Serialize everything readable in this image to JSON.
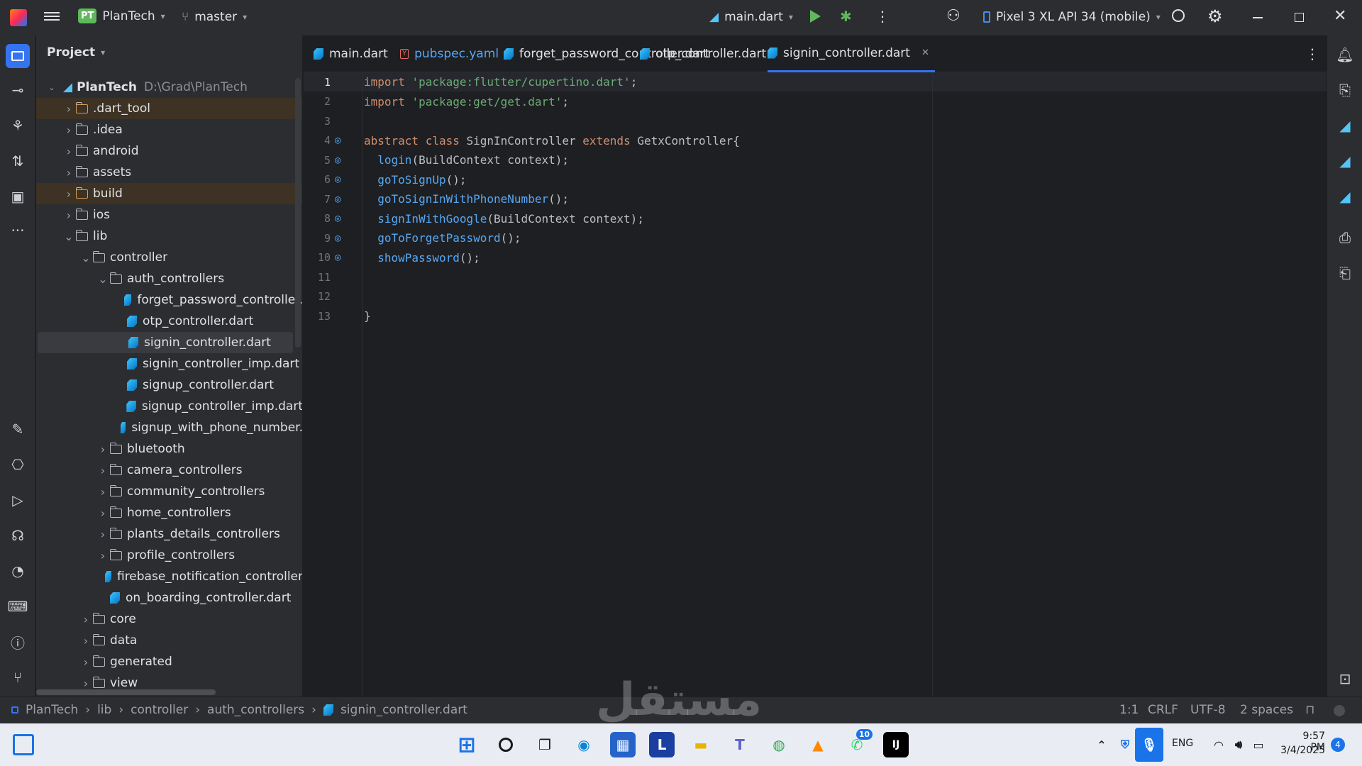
{
  "titlebar": {
    "project_initials": "PT",
    "project_name": "PlanTech",
    "branch": "master",
    "run_config": "main.dart",
    "device": "Pixel 3 XL API 34 (mobile)"
  },
  "project_panel": {
    "title": "Project",
    "root_name": "PlanTech",
    "root_path": "D:\\Grad\\PlanTech",
    "rows": [
      {
        "label": ".dart_tool",
        "depth": 1,
        "kind": "folder",
        "expanded": false,
        "highlight": "excluded"
      },
      {
        "label": ".idea",
        "depth": 1,
        "kind": "folder",
        "expanded": false,
        "highlight": ""
      },
      {
        "label": "android",
        "depth": 1,
        "kind": "folder",
        "expanded": false,
        "highlight": ""
      },
      {
        "label": "assets",
        "depth": 1,
        "kind": "folder",
        "expanded": false,
        "highlight": ""
      },
      {
        "label": "build",
        "depth": 1,
        "kind": "folder",
        "expanded": false,
        "highlight": "excluded"
      },
      {
        "label": "ios",
        "depth": 1,
        "kind": "folder",
        "expanded": false,
        "highlight": ""
      },
      {
        "label": "lib",
        "depth": 1,
        "kind": "folder",
        "expanded": true,
        "highlight": ""
      },
      {
        "label": "controller",
        "depth": 2,
        "kind": "folder",
        "expanded": true,
        "highlight": ""
      },
      {
        "label": "auth_controllers",
        "depth": 3,
        "kind": "folder",
        "expanded": true,
        "highlight": ""
      },
      {
        "label": "forget_password_controller.",
        "depth": 4,
        "kind": "dart",
        "highlight": ""
      },
      {
        "label": "otp_controller.dart",
        "depth": 4,
        "kind": "dart",
        "highlight": ""
      },
      {
        "label": "signin_controller.dart",
        "depth": 4,
        "kind": "dart",
        "highlight": "selected"
      },
      {
        "label": "signin_controller_imp.dart",
        "depth": 4,
        "kind": "dart",
        "highlight": ""
      },
      {
        "label": "signup_controller.dart",
        "depth": 4,
        "kind": "dart",
        "highlight": ""
      },
      {
        "label": "signup_controller_imp.dart",
        "depth": 4,
        "kind": "dart",
        "highlight": ""
      },
      {
        "label": "signup_with_phone_number.",
        "depth": 4,
        "kind": "dart",
        "highlight": ""
      },
      {
        "label": "bluetooth",
        "depth": 3,
        "kind": "folder",
        "expanded": false,
        "highlight": ""
      },
      {
        "label": "camera_controllers",
        "depth": 3,
        "kind": "folder",
        "expanded": false,
        "highlight": ""
      },
      {
        "label": "community_controllers",
        "depth": 3,
        "kind": "folder",
        "expanded": false,
        "highlight": ""
      },
      {
        "label": "home_controllers",
        "depth": 3,
        "kind": "folder",
        "expanded": false,
        "highlight": ""
      },
      {
        "label": "plants_details_controllers",
        "depth": 3,
        "kind": "folder",
        "expanded": false,
        "highlight": ""
      },
      {
        "label": "profile_controllers",
        "depth": 3,
        "kind": "folder",
        "expanded": false,
        "highlight": ""
      },
      {
        "label": "firebase_notification_controller",
        "depth": 3,
        "kind": "dart",
        "highlight": ""
      },
      {
        "label": "on_boarding_controller.dart",
        "depth": 3,
        "kind": "dart",
        "highlight": ""
      },
      {
        "label": "core",
        "depth": 2,
        "kind": "folder",
        "expanded": false,
        "highlight": ""
      },
      {
        "label": "data",
        "depth": 2,
        "kind": "folder",
        "expanded": false,
        "highlight": ""
      },
      {
        "label": "generated",
        "depth": 2,
        "kind": "folder",
        "expanded": false,
        "highlight": ""
      },
      {
        "label": "view",
        "depth": 2,
        "kind": "folder",
        "expanded": false,
        "highlight": ""
      }
    ]
  },
  "tabs": [
    {
      "label": "main.dart",
      "kind": "dart",
      "active": false
    },
    {
      "label": "pubspec.yaml",
      "kind": "yaml",
      "active": false
    },
    {
      "label": "forget_password_controller.dart",
      "kind": "dart",
      "active": false
    },
    {
      "label": "otp_controller.dart",
      "kind": "dart",
      "active": false
    },
    {
      "label": "signin_controller.dart",
      "kind": "dart",
      "active": true
    }
  ],
  "code_lines": [
    {
      "n": "1",
      "gutter": false,
      "tokens": [
        [
          "kw",
          "import "
        ],
        [
          "str",
          "'package:flutter/cupertino.dart'"
        ],
        [
          "cls",
          ";"
        ]
      ]
    },
    {
      "n": "2",
      "gutter": false,
      "tokens": [
        [
          "kw",
          "import "
        ],
        [
          "str",
          "'package:get/get.dart'"
        ],
        [
          "cls",
          ";"
        ]
      ]
    },
    {
      "n": "3",
      "gutter": false,
      "tokens": []
    },
    {
      "n": "4",
      "gutter": true,
      "tokens": [
        [
          "kw",
          "abstract class "
        ],
        [
          "cls",
          "SignInController "
        ],
        [
          "kw",
          "extends "
        ],
        [
          "cls",
          "GetxController{"
        ]
      ]
    },
    {
      "n": "5",
      "gutter": true,
      "tokens": [
        [
          "cls",
          "  "
        ],
        [
          "fn",
          "login"
        ],
        [
          "cls",
          "(BuildContext context);"
        ]
      ]
    },
    {
      "n": "6",
      "gutter": true,
      "tokens": [
        [
          "cls",
          "  "
        ],
        [
          "fn",
          "goToSignUp"
        ],
        [
          "cls",
          "();"
        ]
      ]
    },
    {
      "n": "7",
      "gutter": true,
      "tokens": [
        [
          "cls",
          "  "
        ],
        [
          "fn",
          "goToSignInWithPhoneNumber"
        ],
        [
          "cls",
          "();"
        ]
      ]
    },
    {
      "n": "8",
      "gutter": true,
      "tokens": [
        [
          "cls",
          "  "
        ],
        [
          "fn",
          "signInWithGoogle"
        ],
        [
          "cls",
          "(BuildContext context);"
        ]
      ]
    },
    {
      "n": "9",
      "gutter": true,
      "tokens": [
        [
          "cls",
          "  "
        ],
        [
          "fn",
          "goToForgetPassword"
        ],
        [
          "cls",
          "();"
        ]
      ]
    },
    {
      "n": "10",
      "gutter": true,
      "tokens": [
        [
          "cls",
          "  "
        ],
        [
          "fn",
          "showPassword"
        ],
        [
          "cls",
          "();"
        ]
      ]
    },
    {
      "n": "11",
      "gutter": false,
      "tokens": []
    },
    {
      "n": "12",
      "gutter": false,
      "tokens": []
    },
    {
      "n": "13",
      "gutter": false,
      "tokens": [
        [
          "cls",
          "}"
        ]
      ]
    }
  ],
  "breadcrumb": [
    "PlanTech",
    "lib",
    "controller",
    "auth_controllers",
    "signin_controller.dart"
  ],
  "status": {
    "position": "1:1",
    "line_sep": "CRLF",
    "encoding": "UTF-8",
    "indent": "2 spaces"
  },
  "taskbar": {
    "lang": "ENG",
    "time": "9:57 PM",
    "date": "3/4/2025",
    "notif_count": "4",
    "whatsapp_badge": "10"
  },
  "watermark": "مستقل",
  "colors": {
    "accent": "#3574f0",
    "bg": "#1e1f22",
    "panel": "#2b2d30"
  }
}
